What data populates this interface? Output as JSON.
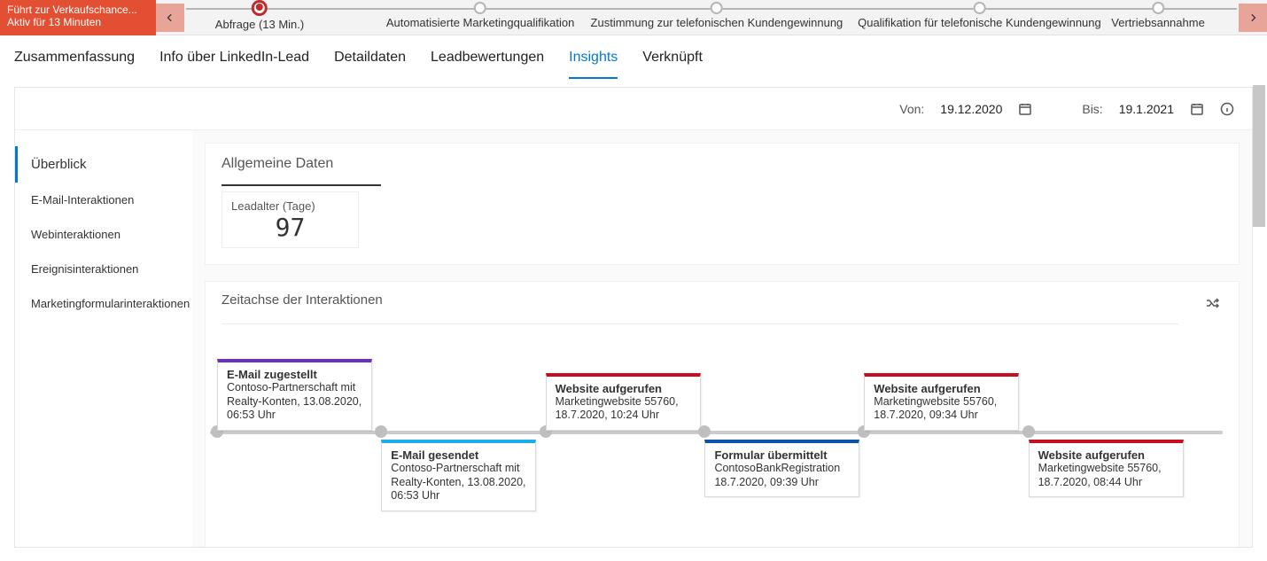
{
  "bpf": {
    "flag_line1": "Führt zur Verkaufschance...",
    "flag_line2": "Aktiv für 13 Minuten",
    "stages": [
      {
        "label": "Abfrage (13 Min.)",
        "active": true,
        "left_pct": 7
      },
      {
        "label": "Automatisierte Marketingqualifikation",
        "left_pct": 28
      },
      {
        "label": "Zustimmung zur telefonischen Kundengewinnung",
        "left_pct": 50.5
      },
      {
        "label": "Qualifikation für telefonische Kundengewinnung",
        "left_pct": 75.5
      },
      {
        "label": "Vertriebsannahme",
        "left_pct": 92.5
      }
    ]
  },
  "tabs": [
    "Zusammenfassung",
    "Info über LinkedIn-Lead",
    "Detaildaten",
    "Leadbewertungen",
    "Insights",
    "Verknüpft"
  ],
  "active_tab": "Insights",
  "date_range": {
    "from_label": "Von:",
    "from": "19.12.2020",
    "to_label": "Bis:",
    "to": "19.1.2021"
  },
  "left_nav": [
    "Überblick",
    "E-Mail-Interaktionen",
    "Webinteraktionen",
    "Ereignisinteraktionen",
    "Marketingformularinteraktionen"
  ],
  "active_left": "Überblick",
  "general": {
    "heading": "Allgemeine Daten",
    "kpi_label": "Leadalter (Tage)",
    "kpi_value": "97"
  },
  "timeline": {
    "heading": "Zeitachse der Interaktionen",
    "events": [
      {
        "pos": 0,
        "above": true,
        "color": "purple",
        "title": "E-Mail zugestellt",
        "desc": "Contoso-Partnerschaft mit Realty-Konten, 13.08.2020, 06:53 Uhr"
      },
      {
        "pos": 17,
        "above": false,
        "color": "cyan",
        "title": "E-Mail gesendet",
        "desc": "Contoso-Partnerschaft mit Realty-Konten, 13.08.2020, 06:53 Uhr"
      },
      {
        "pos": 34,
        "above": true,
        "color": "red",
        "title": "Website aufgerufen",
        "desc": "Marketingwebsite 55760, 18.7.2020, 10:24 Uhr"
      },
      {
        "pos": 50.5,
        "above": false,
        "color": "blue",
        "title": "Formular übermittelt",
        "desc": "ContosoBankRegistration 18.7.2020, 09:39 Uhr"
      },
      {
        "pos": 67,
        "above": true,
        "color": "red",
        "title": "Website aufgerufen",
        "desc": "Marketingwebsite 55760, 18.7.2020, 09:34 Uhr"
      },
      {
        "pos": 84,
        "above": false,
        "color": "red",
        "title": "Website aufgerufen",
        "desc": "Marketingwebsite 55760, 18.7.2020, 08:44 Uhr"
      }
    ]
  }
}
